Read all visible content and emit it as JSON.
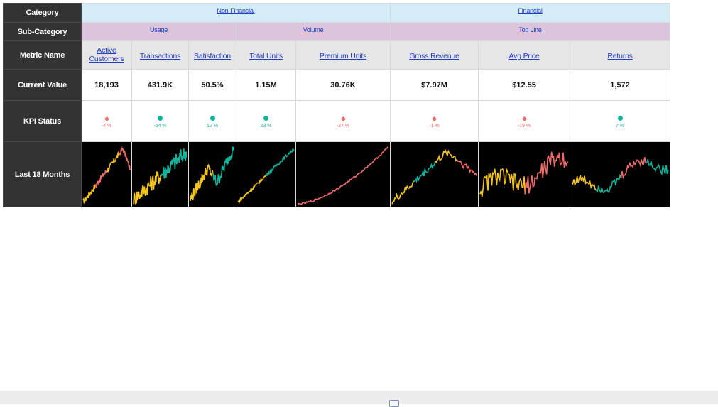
{
  "row_labels": {
    "category": "Category",
    "sub_category": "Sub-Category",
    "metric_name": "Metric Name",
    "current_value": "Current Value",
    "kpi_status": "KPI Status",
    "sparkline": "Last 18 Months"
  },
  "categories": [
    {
      "label": "Non-Financial",
      "span": 5
    },
    {
      "label": "Financial",
      "span": 3
    }
  ],
  "sub_categories": [
    {
      "label": "Usage",
      "span": 3
    },
    {
      "label": "Volume",
      "span": 2
    },
    {
      "label": "Top Line",
      "span": 3
    }
  ],
  "metrics": [
    {
      "name": "Active Customers",
      "value": "18,193",
      "status": "down",
      "change": "-4 %"
    },
    {
      "name": "Transactions",
      "value": "431.9K",
      "status": "up",
      "change": "-54 %"
    },
    {
      "name": "Satisfaction",
      "value": "50.5%",
      "status": "up",
      "change": "12 %"
    },
    {
      "name": "Total Units",
      "value": "1.15M",
      "status": "up",
      "change": "23 %"
    },
    {
      "name": "Premium Units",
      "value": "30.76K",
      "status": "down",
      "change": "-27 %"
    },
    {
      "name": "Gross Revenue",
      "value": "$7.97M",
      "status": "down",
      "change": "-1 %"
    },
    {
      "name": "Avg Price",
      "value": "$12.55",
      "status": "down",
      "change": "-19 %"
    },
    {
      "name": "Returns",
      "value": "1,572",
      "status": "up",
      "change": "7 %"
    }
  ],
  "colors": {
    "header_bg": "#333333",
    "category_bg": "#d4ecf8",
    "subcategory_bg": "#dcc4dc",
    "metric_bg": "#e6e6e6",
    "good": "#0fb59b",
    "bad": "#f26b6b",
    "neutral_trend": "#f5c518",
    "spark_bg": "#000000"
  },
  "icons": {
    "up": "teal-dot-icon",
    "down": "red-diamond-icon"
  },
  "sparklines": [
    {
      "shape": "ramp-peak",
      "segments": [
        "#f5c518",
        "#f26b6b",
        "#f5c518",
        "#f26b6b"
      ]
    },
    {
      "shape": "rise-noisy",
      "segments": [
        "#f5c518",
        "#0fb59b"
      ]
    },
    {
      "shape": "rise-dip-rise",
      "segments": [
        "#f5c518",
        "#0fb59b"
      ]
    },
    {
      "shape": "linear",
      "segments": [
        "#f5c518",
        "#0fb59b"
      ]
    },
    {
      "shape": "exp",
      "segments": [
        "#f26b6b"
      ]
    },
    {
      "shape": "rise-hump",
      "segments": [
        "#f5c518",
        "#0fb59b",
        "#f5c518",
        "#f26b6b"
      ]
    },
    {
      "shape": "volatile",
      "segments": [
        "#f5c518",
        "#f26b6b"
      ]
    },
    {
      "shape": "wave",
      "segments": [
        "#f5c518",
        "#0fb59b",
        "#f26b6b",
        "#0fb59b"
      ]
    }
  ]
}
